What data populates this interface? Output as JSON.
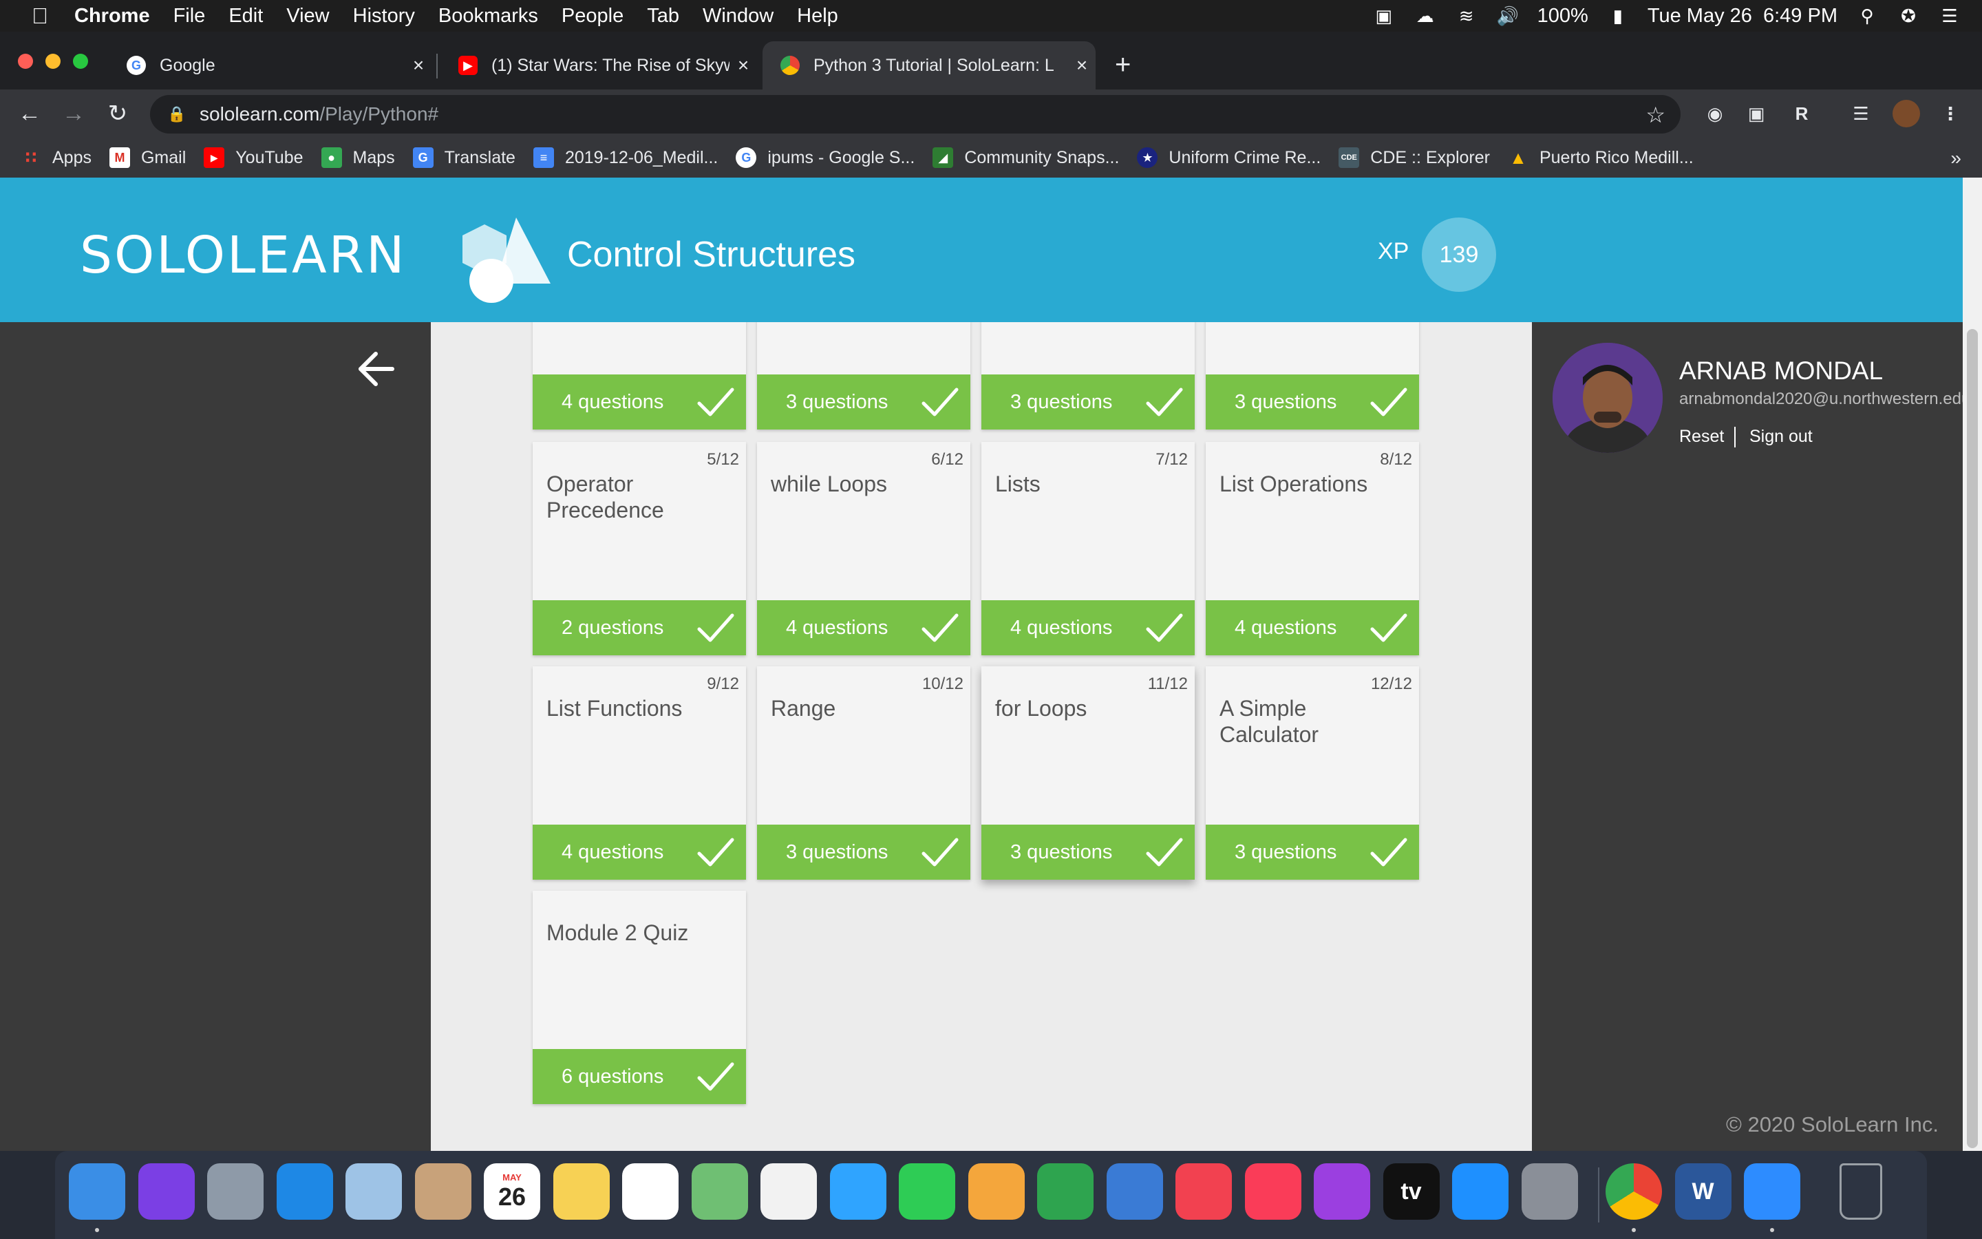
{
  "menubar": {
    "app": "Chrome",
    "items": [
      "File",
      "Edit",
      "View",
      "History",
      "Bookmarks",
      "People",
      "Tab",
      "Window",
      "Help"
    ],
    "battery": "100%",
    "datetime": "Tue May 26  6:49 PM"
  },
  "tabs": [
    {
      "title": "Google",
      "favicon": "google-icon"
    },
    {
      "title": "(1) Star Wars: The Rise of Skyw",
      "favicon": "youtube-icon"
    },
    {
      "title": "Python 3 Tutorial | SoloLearn: L",
      "favicon": "chrome-icon",
      "active": true
    }
  ],
  "address": {
    "host": "sololearn.com",
    "path": "/Play/Python#"
  },
  "bookmarks": [
    {
      "label": "Apps",
      "icon": "apps-grid-icon",
      "color": "#ea4335"
    },
    {
      "label": "Gmail",
      "icon": "gmail-icon",
      "color": "#d93025"
    },
    {
      "label": "YouTube",
      "icon": "youtube-icon",
      "color": "#ff0000"
    },
    {
      "label": "Maps",
      "icon": "maps-icon",
      "color": "#34a853"
    },
    {
      "label": "Translate",
      "icon": "translate-icon",
      "color": "#4285f4"
    },
    {
      "label": "2019-12-06_Medil...",
      "icon": "docs-icon",
      "color": "#4285f4"
    },
    {
      "label": "ipums - Google S...",
      "icon": "google-icon",
      "color": "#ffffff"
    },
    {
      "label": "Community Snaps...",
      "icon": "community-icon",
      "color": "#2e7d32"
    },
    {
      "label": "Uniform Crime Re...",
      "icon": "fbi-seal-icon",
      "color": "#1a237e"
    },
    {
      "label": "CDE :: Explorer",
      "icon": "cde-icon",
      "color": "#455a64"
    },
    {
      "label": "Puerto Rico Medill...",
      "icon": "drive-icon",
      "color": "#fbbc04"
    }
  ],
  "header": {
    "logo": "SOLOLEARN",
    "module_title": "Control Structures",
    "xp_label": "XP",
    "xp_value": "139"
  },
  "lessons_top": [
    {
      "questions": "4 questions"
    },
    {
      "questions": "3 questions"
    },
    {
      "questions": "3 questions"
    },
    {
      "questions": "3 questions"
    }
  ],
  "lessons": [
    {
      "num": "5/12",
      "name": "Operator Precedence",
      "questions": "2 questions"
    },
    {
      "num": "6/12",
      "name": "while Loops",
      "questions": "4 questions"
    },
    {
      "num": "7/12",
      "name": "Lists",
      "questions": "4 questions"
    },
    {
      "num": "8/12",
      "name": "List Operations",
      "questions": "4 questions"
    },
    {
      "num": "9/12",
      "name": "List Functions",
      "questions": "4 questions"
    },
    {
      "num": "10/12",
      "name": "Range",
      "questions": "3 questions"
    },
    {
      "num": "11/12",
      "name": "for Loops",
      "questions": "3 questions"
    },
    {
      "num": "12/12",
      "name": "A Simple Calculator",
      "questions": "3 questions"
    },
    {
      "num": "",
      "name": "Module 2 Quiz",
      "questions": "6 questions"
    }
  ],
  "profile": {
    "name": "ARNAB MONDAL",
    "email": "arnabmondal2020@u.northwestern.edu",
    "reset": "Reset",
    "signout": "Sign out"
  },
  "footer": {
    "copyright": "© 2020 SoloLearn Inc."
  },
  "colors": {
    "header": "#29aad2",
    "complete": "#79c247",
    "xp_badge": "#66c5e1"
  },
  "dock": [
    {
      "name": "finder-icon",
      "color": "#3a8ee6"
    },
    {
      "name": "siri-icon",
      "color": "#7b3fe4"
    },
    {
      "name": "launchpad-icon",
      "color": "#8e9aa8"
    },
    {
      "name": "safari-icon",
      "color": "#1e88e5"
    },
    {
      "name": "preview-icon",
      "color": "#9ec3e6"
    },
    {
      "name": "contacts-icon",
      "color": "#c8a27a"
    },
    {
      "name": "calendar-icon",
      "color": "#ffffff",
      "text": "26",
      "label": "MAY"
    },
    {
      "name": "notes-icon",
      "color": "#f7d154"
    },
    {
      "name": "reminders-icon",
      "color": "#ffffff"
    },
    {
      "name": "maps-icon",
      "color": "#6fbf73"
    },
    {
      "name": "photos-icon",
      "color": "#f2f2f2"
    },
    {
      "name": "messages-icon",
      "color": "#2fa4ff"
    },
    {
      "name": "facetime-icon",
      "color": "#2ecc55"
    },
    {
      "name": "pages-icon",
      "color": "#f4a63c"
    },
    {
      "name": "numbers-icon",
      "color": "#2ea44f"
    },
    {
      "name": "keynote-icon",
      "color": "#3a7bd5"
    },
    {
      "name": "news-icon",
      "color": "#f24150"
    },
    {
      "name": "music-icon",
      "color": "#fa3c58"
    },
    {
      "name": "podcasts-icon",
      "color": "#9b3fe0"
    },
    {
      "name": "apple-tv-icon",
      "color": "#111111",
      "text": "tv"
    },
    {
      "name": "app-store-icon",
      "color": "#1e90ff"
    },
    {
      "name": "system-preferences-icon",
      "color": "#8a8f98"
    },
    {
      "name": "chrome-icon",
      "color": "#ffffff"
    },
    {
      "name": "word-icon",
      "color": "#2b579a",
      "text": "W"
    },
    {
      "name": "zoom-icon",
      "color": "#2d8cff"
    },
    {
      "name": "trash-icon",
      "color": "#9aa0a6"
    }
  ]
}
